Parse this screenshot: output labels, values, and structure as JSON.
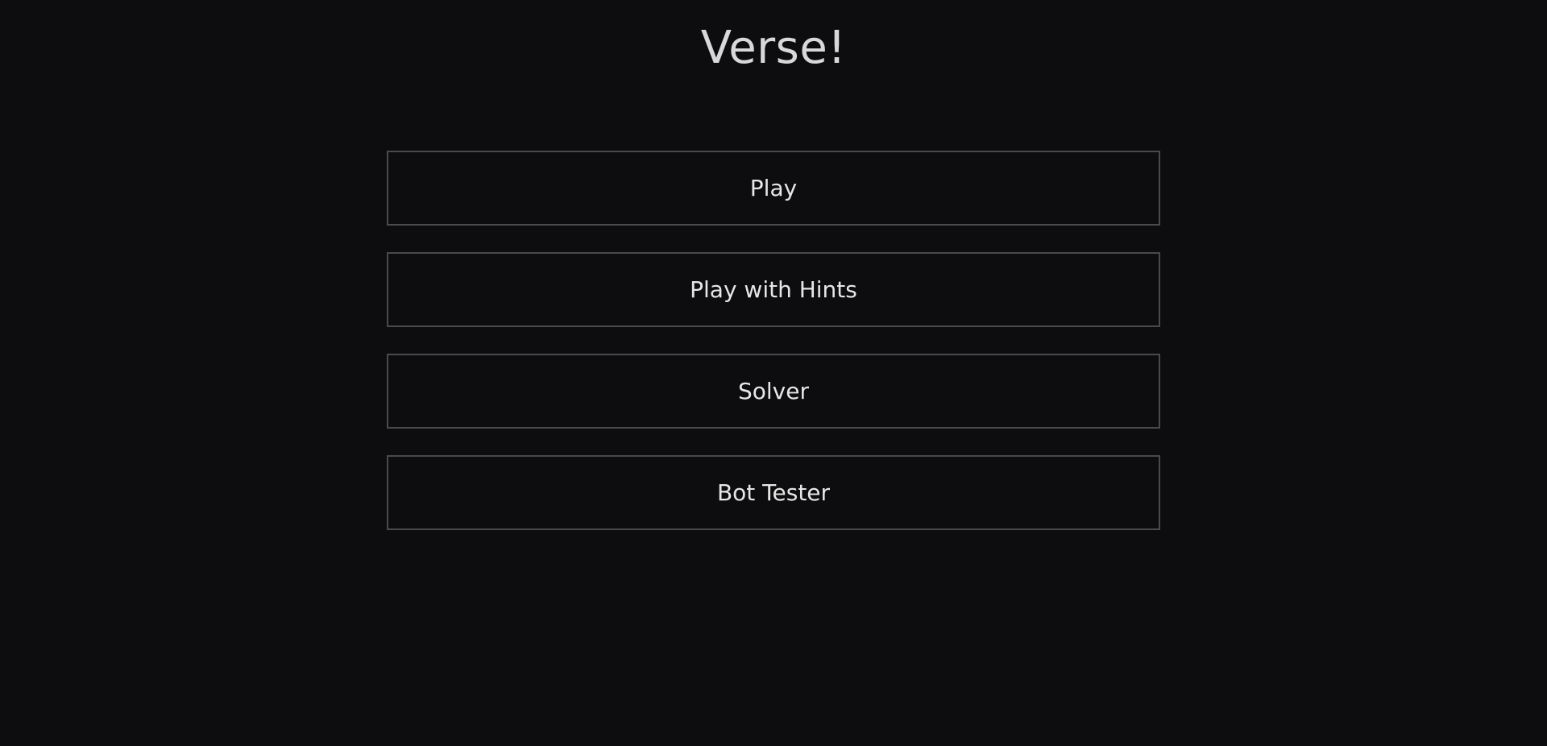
{
  "app": {
    "title": "Verse!"
  },
  "menu": {
    "items": [
      {
        "label": "Play"
      },
      {
        "label": "Play with Hints"
      },
      {
        "label": "Solver"
      },
      {
        "label": "Bot Tester"
      }
    ]
  },
  "colors": {
    "background": "#0d0d0f",
    "button_border": "#4a4a4d",
    "text": "#e6e6e6"
  }
}
